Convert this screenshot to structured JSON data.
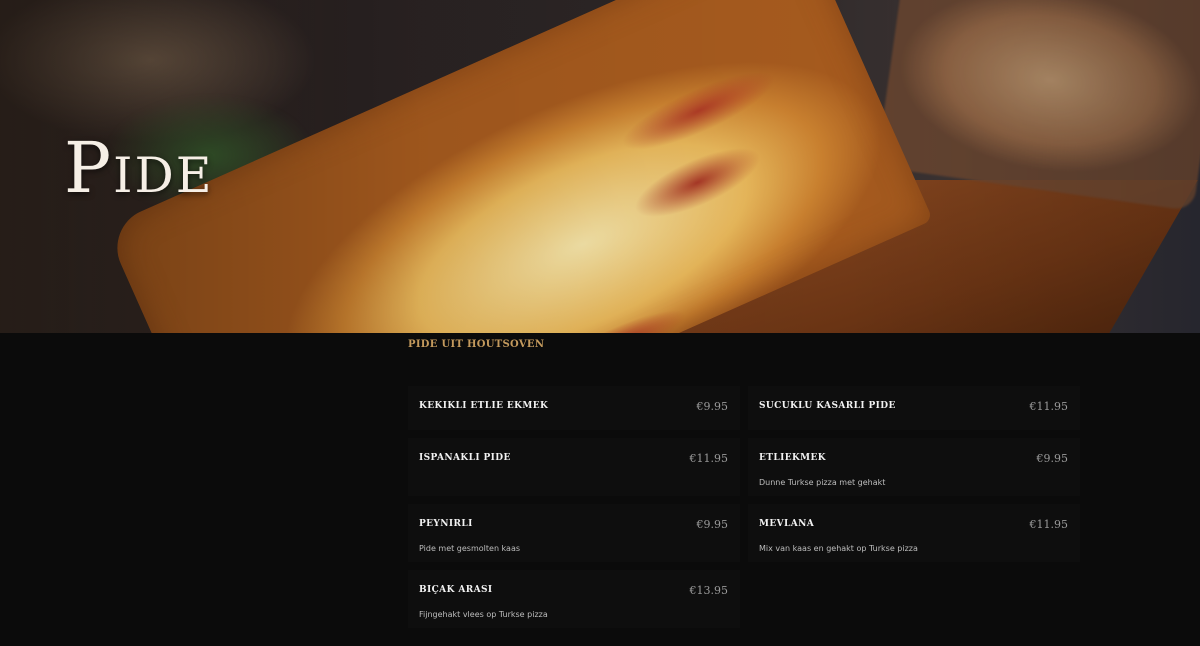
{
  "hero": {
    "title": "Pide"
  },
  "section": {
    "heading": "PIDE UIT HOUTSOVEN"
  },
  "menu_items": [
    {
      "name": "KEKIKLI ETLIE EKMEK",
      "price": "€9.95",
      "description": ""
    },
    {
      "name": "SUCUKLU KASARLI PIDE",
      "price": "€11.95",
      "description": ""
    },
    {
      "name": "ISPANAKLI PIDE",
      "price": "€11.95",
      "description": ""
    },
    {
      "name": "ETLIEKMEK",
      "price": "€9.95",
      "description": "Dunne Turkse pizza met gehakt"
    },
    {
      "name": "PEYNIRLI",
      "price": "€9.95",
      "description": "Pide met gesmolten kaas"
    },
    {
      "name": "MEVLANA",
      "price": "€11.95",
      "description": "Mix van kaas en gehakt op Turkse pizza"
    },
    {
      "name": "BIÇAK ARASI",
      "price": "€13.95",
      "description": "Fijngehakt vlees op Turkse pizza"
    }
  ]
}
